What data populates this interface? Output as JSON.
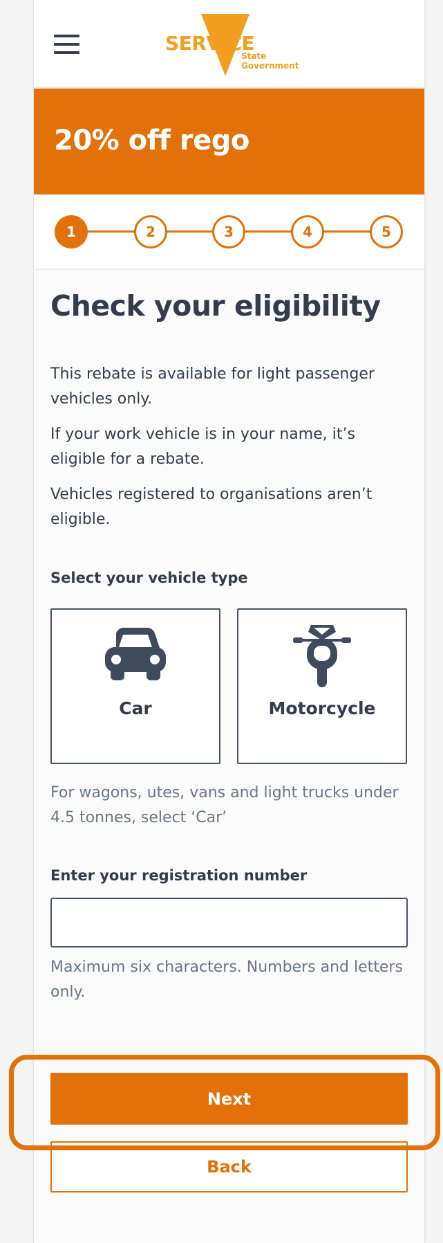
{
  "header": {
    "menu_icon": "hamburger-icon",
    "logo": {
      "word": "SERVICE",
      "line1": "State",
      "line2": "Government",
      "color": "#f29f1f"
    }
  },
  "banner": {
    "title": "20% off rego",
    "color": "#e2710a"
  },
  "stepper": {
    "steps": [
      "1",
      "2",
      "3",
      "4",
      "5"
    ],
    "current": 1
  },
  "main": {
    "heading": "Check your eligibility",
    "paragraphs": [
      "This rebate is available for light passenger vehicles only.",
      "If your work vehicle is in your name, it’s eligible for a rebate.",
      "Vehicles registered to organisations aren’t eligible."
    ],
    "vehicle_type_label": "Select your vehicle type",
    "vehicle_options": [
      {
        "label": "Car",
        "icon": "car-icon"
      },
      {
        "label": "Motorcycle",
        "icon": "motorcycle-icon"
      }
    ],
    "vehicle_hint": "For wagons, utes, vans and light trucks under 4.5 tonnes, select ‘Car’",
    "registration_label": "Enter your registration number",
    "registration_value": "",
    "registration_hint": "Maximum six characters. Numbers and letters only."
  },
  "actions": {
    "next_label": "Next",
    "back_label": "Back"
  },
  "colors": {
    "accent": "#e2710a",
    "text": "#333c4d",
    "hint": "#6b7585"
  }
}
